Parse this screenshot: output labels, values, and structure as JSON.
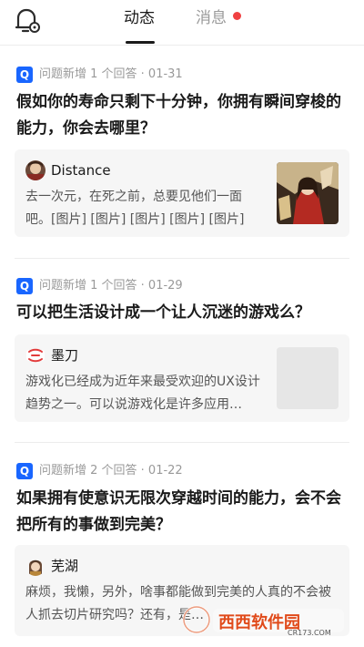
{
  "tabs": {
    "active": "动态",
    "inactive": "消息"
  },
  "feed": [
    {
      "badge": "Q",
      "meta": "问题新增 1 个回答 · 01-31",
      "title": "假如你的寿命只剩下十分钟，你拥有瞬间穿梭的能力，你会去哪里？",
      "author": "Distance",
      "excerpt": "去一次元，在死之前，总要见他们一面吧。[图片] [图片] [图片] [图片] [图片]"
    },
    {
      "badge": "Q",
      "meta": "问题新增 1 个回答 · 01-29",
      "title": "可以把生活设计成一个让人沉迷的游戏么？",
      "author": "墨刀",
      "excerpt": "游戏化已经成为近年来最受欢迎的UX设计趋势之一。可以说游戏化是许多应用…"
    },
    {
      "badge": "Q",
      "meta": "问题新增 2 个回答 · 01-22",
      "title": "如果拥有使意识无限次穿越时间的能力，会不会把所有的事做到完美？",
      "author": "芜湖",
      "excerpt": "麻烦，我懒，另外，啥事都能做到完美的人真的不会被人抓去切片研究吗？还有，是…"
    }
  ],
  "watermark": {
    "brand": "西西软件园",
    "site": "CR173.COM"
  },
  "colors": {
    "accent_blue": "#1966ff",
    "badge_dot": "#f04142",
    "card_bg": "#f6f6f6"
  },
  "icons": [
    "notification-bell-icon",
    "question-badge-icon"
  ]
}
